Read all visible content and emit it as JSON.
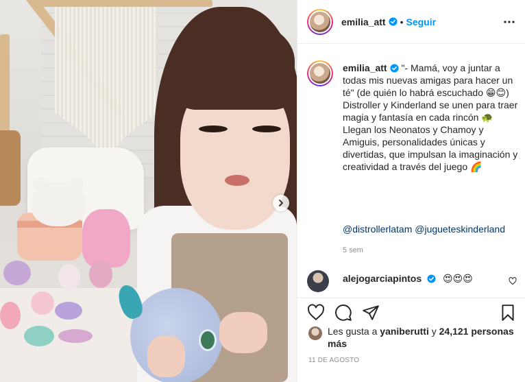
{
  "post": {
    "username": "emilia_att",
    "follow_label": "Seguir",
    "dot": "•",
    "caption_username": "emilia_att",
    "caption_text": "\"- Mamá, voy a juntar a todas mis nuevas amigas para hacer un té\" (de quién lo habrá escuchado 😁😊)\nDistroller y Kinderland se unen para traer magia y fantasía en cada rincón 🐢\nLlegan los Neonatos y Chamoy y Amiguis, personalidades únicas y divertidas, que impulsan la imaginación y creatividad a través del juego 🌈",
    "mentions": [
      "@distrollerlatam",
      "@jugueteskinderland"
    ],
    "time_ago": "5 sem",
    "comment": {
      "username": "alejogarciapintos",
      "text": "😍😍😍"
    },
    "likes": {
      "prefix": "Les gusta a",
      "user": "yaniberutti",
      "connector": "y",
      "count_text": "24,121 personas más"
    },
    "date": "11 DE AGOSTO"
  },
  "icons": {
    "verified": "verified-badge-icon",
    "more": "more-options-icon",
    "next": "chevron-right-icon",
    "like": "heart-icon",
    "comment": "comment-icon",
    "share": "share-icon",
    "save": "bookmark-icon"
  },
  "colors": {
    "accent": "#0095f6",
    "mention": "#00376b",
    "muted": "#8e8e8e",
    "text": "#262626"
  }
}
